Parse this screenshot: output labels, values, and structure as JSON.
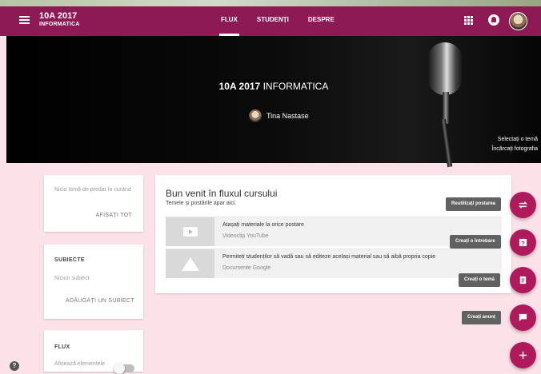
{
  "header": {
    "title": "10A 2017",
    "subtitle": "INFORMATICA",
    "tabs": [
      {
        "label": "FLUX",
        "active": true
      },
      {
        "label": "STUDENȚI",
        "active": false
      },
      {
        "label": "DESPRE",
        "active": false
      }
    ]
  },
  "hero": {
    "class_name": "10A 2017",
    "subject": "INFORMATICA",
    "teacher": "Tina Nastase",
    "select_theme": "Selectați o temă",
    "upload_photo": "Încărcați fotografia"
  },
  "sidebar": {
    "upcoming": {
      "empty_text": "Nicio temă de predat în curând",
      "view_all": "AFIȘAȚI TOT"
    },
    "topics": {
      "title": "SUBIECTE",
      "empty_text": "Niciun subiect",
      "add_label": "ADĂUGAȚI UN SUBIECT"
    },
    "stream": {
      "title": "FLUX",
      "show_items": "Afișează elementele"
    }
  },
  "welcome": {
    "title": "Bun venit în fluxul cursului",
    "subtitle": "Temele și postările apar aici.",
    "items": [
      {
        "title": "Atașați materiale la orice postare",
        "subtitle": "Videoclip YouTube"
      },
      {
        "title": "Permiteți studenților să vadă sau să editeze același material sau să aibă propria copie",
        "subtitle": "Documente Google"
      }
    ]
  },
  "actions": {
    "reuse": "Reutilizați postarea",
    "question": "Creați o întrebare",
    "assignment": "Creați o temă",
    "announcement": "Creați anunț"
  },
  "colors": {
    "primary": "#8e1a55",
    "accent": "#b0195b",
    "background": "#fbe1e8"
  }
}
